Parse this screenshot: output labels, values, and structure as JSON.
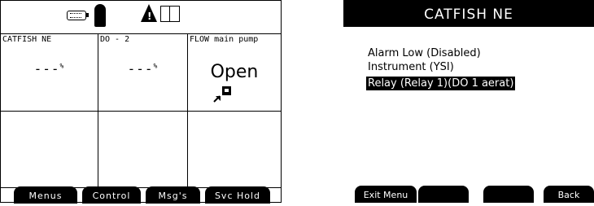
{
  "left_screen": {
    "cells": [
      {
        "title": "CATFISH NE",
        "value": "---",
        "unit": "%"
      },
      {
        "title": "DO - 2",
        "value": "---",
        "unit": "%"
      },
      {
        "title": "FLOW main pump",
        "value": "Open"
      }
    ],
    "softkeys": [
      "Menus",
      "Control",
      "Msg's",
      "Svc Hold"
    ]
  },
  "right_screen": {
    "title": "CATFISH NE",
    "items": [
      {
        "label": "Alarm Low (Disabled)",
        "selected": false
      },
      {
        "label": "Instrument (YSI)",
        "selected": false
      },
      {
        "label": "Relay (Relay 1)(DO 1 aerat)",
        "selected": true
      }
    ],
    "softkeys": [
      "Exit Menu",
      "",
      "",
      "Back"
    ]
  }
}
